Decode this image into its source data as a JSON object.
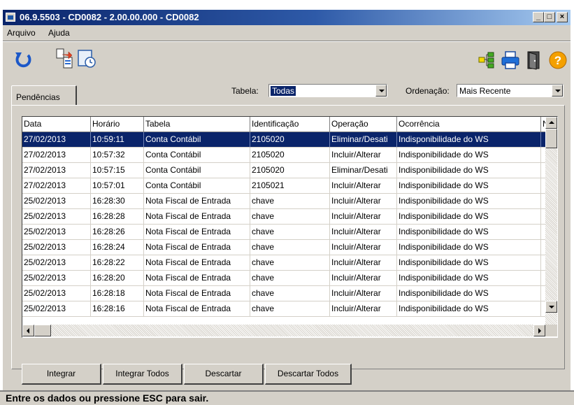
{
  "window": {
    "title": "06.9.5503 - CD0082 - 2.00.00.000 - CD0082"
  },
  "menu": {
    "items": [
      {
        "label": "Arquivo"
      },
      {
        "label": "Ajuda"
      }
    ]
  },
  "toolbar": {
    "left_icons": [
      "refresh-icon",
      "transfer-icon",
      "schedule-icon"
    ],
    "right_icons": [
      "tree-icon",
      "print-icon",
      "exit-door-icon",
      "help-icon"
    ]
  },
  "tabs": [
    {
      "label": "Pendências",
      "active": true
    }
  ],
  "filters": {
    "tabela_label": "Tabela:",
    "tabela_value": "Todas",
    "ordenacao_label": "Ordenação:",
    "ordenacao_value": "Mais Recente"
  },
  "grid": {
    "columns": [
      "Data",
      "Horário",
      "Tabela",
      "Identificação",
      "Operação",
      "Ocorrência",
      "N"
    ],
    "selected_row": 0,
    "rows": [
      [
        "27/02/2013",
        "10:59:11",
        "Conta Contábil",
        "2105020",
        "Eliminar/Desati",
        "Indisponibilidade do WS"
      ],
      [
        "27/02/2013",
        "10:57:32",
        "Conta Contábil",
        "2105020",
        "Incluir/Alterar",
        "Indisponibilidade do WS"
      ],
      [
        "27/02/2013",
        "10:57:15",
        "Conta Contábil",
        "2105020",
        "Eliminar/Desati",
        "Indisponibilidade do WS"
      ],
      [
        "27/02/2013",
        "10:57:01",
        "Conta Contábil",
        "2105021",
        "Incluir/Alterar",
        "Indisponibilidade do WS"
      ],
      [
        "25/02/2013",
        "16:28:30",
        "Nota Fiscal de Entrada",
        "chave",
        "Incluir/Alterar",
        "Indisponibilidade do WS"
      ],
      [
        "25/02/2013",
        "16:28:28",
        "Nota Fiscal de Entrada",
        "chave",
        "Incluir/Alterar",
        "Indisponibilidade do WS"
      ],
      [
        "25/02/2013",
        "16:28:26",
        "Nota Fiscal de Entrada",
        "chave",
        "Incluir/Alterar",
        "Indisponibilidade do WS"
      ],
      [
        "25/02/2013",
        "16:28:24",
        "Nota Fiscal de Entrada",
        "chave",
        "Incluir/Alterar",
        "Indisponibilidade do WS"
      ],
      [
        "25/02/2013",
        "16:28:22",
        "Nota Fiscal de Entrada",
        "chave",
        "Incluir/Alterar",
        "Indisponibilidade do WS"
      ],
      [
        "25/02/2013",
        "16:28:20",
        "Nota Fiscal de Entrada",
        "chave",
        "Incluir/Alterar",
        "Indisponibilidade do WS"
      ],
      [
        "25/02/2013",
        "16:28:18",
        "Nota Fiscal de Entrada",
        "chave",
        "Incluir/Alterar",
        "Indisponibilidade do WS"
      ],
      [
        "25/02/2013",
        "16:28:16",
        "Nota Fiscal de Entrada",
        "chave",
        "Incluir/Alterar",
        "Indisponibilidade do WS"
      ]
    ]
  },
  "buttons": {
    "integrar": "Integrar",
    "integrar_todos": "Integrar Todos",
    "descartar": "Descartar",
    "descartar_todos": "Descartar Todos"
  },
  "status": {
    "message": "Entre os dados ou pressione ESC para sair."
  },
  "colors": {
    "selection": "#0a246a",
    "face": "#d4d0c8",
    "title_start": "#0a246a",
    "title_end": "#a6caf0"
  }
}
